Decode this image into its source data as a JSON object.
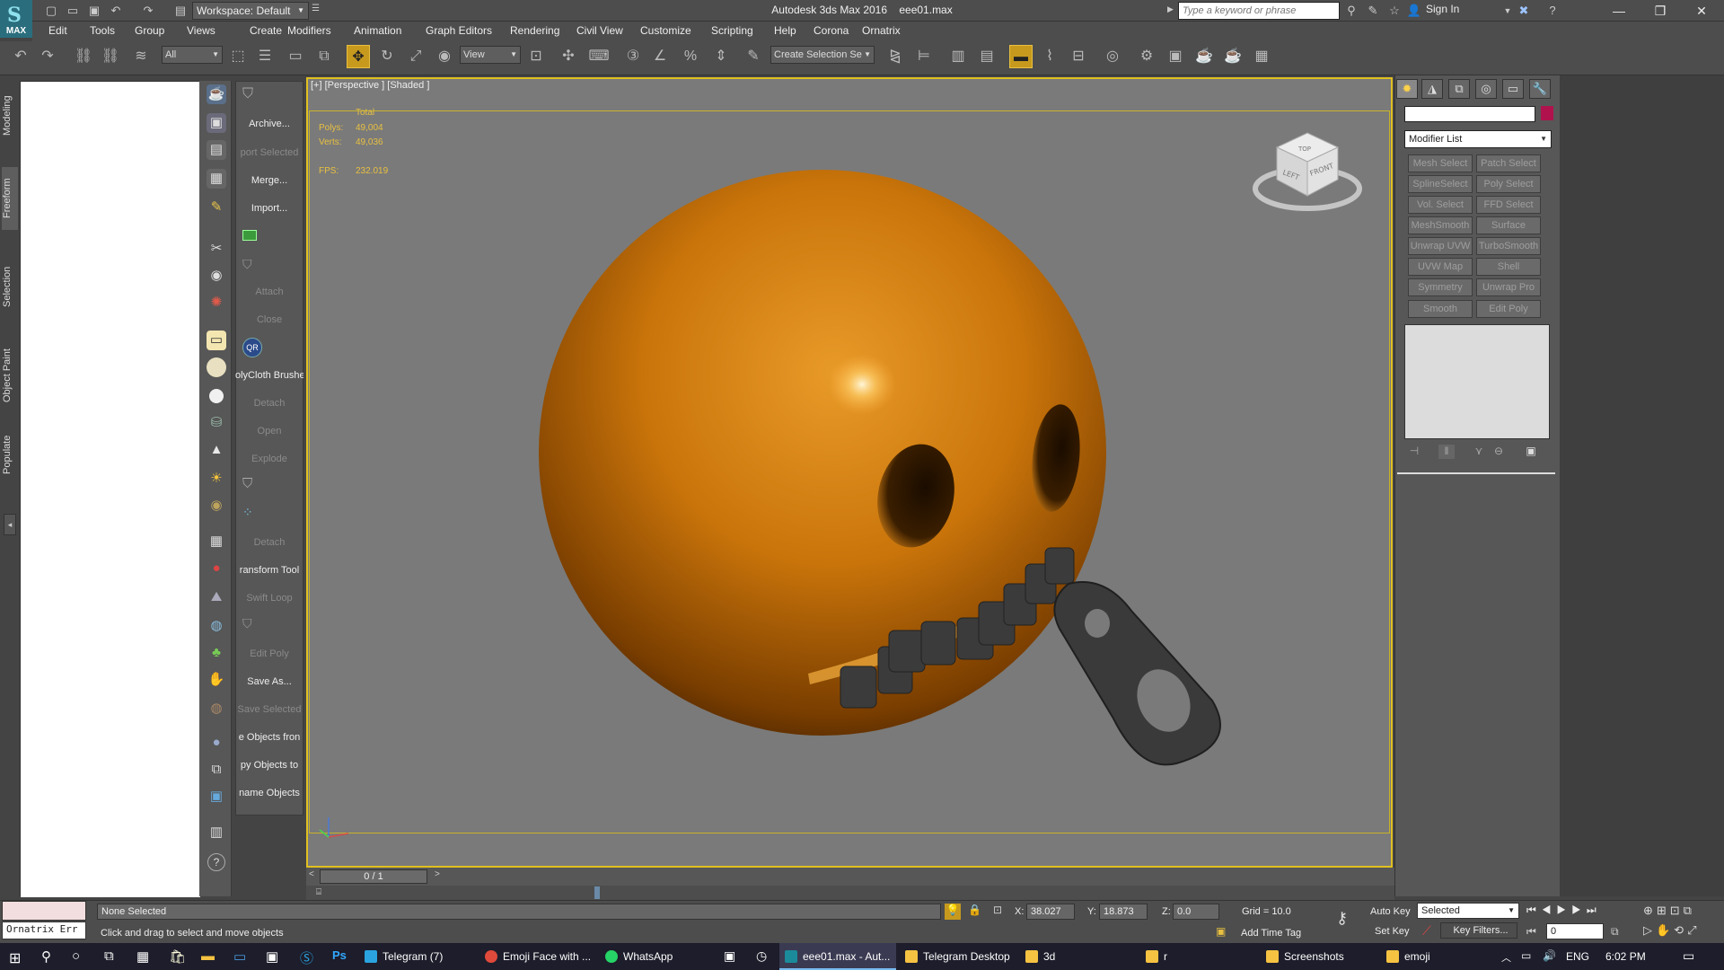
{
  "app": {
    "title": "Autodesk 3ds Max 2016",
    "file": "eee01.max",
    "logo_text": "MAX"
  },
  "workspace": "Workspace: Default",
  "search": {
    "placeholder": "Type a keyword or phrase"
  },
  "signin": "Sign In",
  "menu": [
    "Edit",
    "Tools",
    "Group",
    "Views",
    "Create",
    "Modifiers",
    "Animation",
    "Graph Editors",
    "Rendering",
    "Civil View",
    "Customize",
    "Scripting",
    "Help",
    "Corona",
    "Ornatrix"
  ],
  "toolbar": {
    "filter": "All",
    "refcoord": "View",
    "selset": "Create Selection Se"
  },
  "ribbon_tabs": [
    "Modeling",
    "Freeform",
    "Selection",
    "Object Paint",
    "Populate"
  ],
  "commands": [
    {
      "label": "Archive...",
      "dim": false
    },
    {
      "label": "port Selected",
      "dim": true
    },
    {
      "label": "Merge...",
      "dim": false
    },
    {
      "label": "Import...",
      "dim": false
    },
    {
      "label": "Attach",
      "dim": true
    },
    {
      "label": "Close",
      "dim": true
    },
    {
      "label": "olyCloth Brushe",
      "dim": false
    },
    {
      "label": "Detach",
      "dim": true
    },
    {
      "label": "Open",
      "dim": true
    },
    {
      "label": "Explode",
      "dim": true
    },
    {
      "label": "Detach",
      "dim": true
    },
    {
      "label": "ransform Tool",
      "dim": false
    },
    {
      "label": "Swift Loop",
      "dim": true
    },
    {
      "label": "Edit Poly",
      "dim": true
    },
    {
      "label": "Save As...",
      "dim": false
    },
    {
      "label": "Save Selected",
      "dim": true
    },
    {
      "label": "e Objects fron",
      "dim": false
    },
    {
      "label": "py Objects to",
      "dim": false
    },
    {
      "label": "name Objects",
      "dim": false
    }
  ],
  "qr_label": "QR",
  "viewport": {
    "label": "[+] [Perspective ] [Shaded ]",
    "stats": {
      "total_label": "Total",
      "polys_label": "Polys:",
      "polys": "49,004",
      "verts_label": "Verts:",
      "verts": "49,036",
      "fps_label": "FPS:",
      "fps": "232.019"
    },
    "viewcube": {
      "top": "TOP",
      "left": "LEFT",
      "front": "FRONT"
    },
    "object_color": "#d07a08"
  },
  "modifier_list": "Modifier List",
  "modifier_buttons": [
    "Mesh Select",
    "Patch Select",
    "SplineSelect",
    "Poly Select",
    "Vol. Select",
    "FFD Select",
    "MeshSmooth",
    "Surface Select",
    "Unwrap UVW",
    "TurboSmooth",
    "UVW Map",
    "Shell",
    "Symmetry",
    "Unwrap Pro",
    "Smooth",
    "Edit Poly"
  ],
  "timeline": {
    "frame": "0 / 1"
  },
  "status": {
    "selection": "None Selected",
    "prompt": "Click and drag to select and move objects",
    "script_label": "Ornatrix Err",
    "x_label": "X:",
    "x": "38.027",
    "y_label": "Y:",
    "y": "18.873",
    "z_label": "Z:",
    "z": "0.0",
    "grid": "Grid = 10.0",
    "add_time_tag": "Add Time Tag",
    "auto_key": "Auto Key",
    "set_key": "Set Key",
    "selected": "Selected",
    "key_filters": "Key Filters...",
    "frame_value": "0"
  },
  "taskbar": {
    "items": [
      {
        "label": "Telegram (7)",
        "color": "#2aa3df"
      },
      {
        "label": "Emoji Face with ...",
        "color": "#e04a3a"
      },
      {
        "label": "WhatsApp",
        "color": "#25d366"
      },
      {
        "label": "eee01.max - Aut...",
        "color": "#1b8a9a"
      },
      {
        "label": "Telegram Desktop",
        "color": "#f5c242"
      },
      {
        "label": "3d",
        "color": "#f5c242"
      },
      {
        "label": "r",
        "color": "#f5c242"
      },
      {
        "label": "Screenshots",
        "color": "#f5c242"
      },
      {
        "label": "emoji",
        "color": "#f5c242"
      }
    ],
    "lang": "ENG",
    "time": "6:02 PM"
  },
  "accent_color": "#e0c020"
}
